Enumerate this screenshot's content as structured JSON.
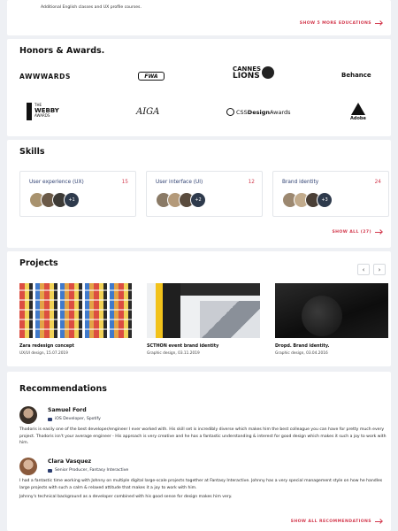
{
  "education": {
    "courses_line": "Additional English classes and UX profile courses.",
    "show_more": "SHOW 5 MORE EDUCATIONS"
  },
  "honors": {
    "title": "Honors & Awards.",
    "logos": {
      "awwwards": "AWWWARDS",
      "fwa": "FWA",
      "cannes_top": "CANNES",
      "cannes_bottom": "LIONS",
      "behance": "Behance",
      "webby_the": "THE",
      "webby_main": "WEBBY",
      "webby_awards": "AWARDS",
      "aiga": "AIGA",
      "css_prefix": "CSS",
      "css_design": "Design",
      "css_awards": "Awards",
      "adobe": "Adobe"
    }
  },
  "skills": {
    "title": "Skills",
    "items": [
      {
        "name": "User experience (UX)",
        "count": "15",
        "more": "+1"
      },
      {
        "name": "User interface (UI)",
        "count": "12",
        "more": "+2"
      },
      {
        "name": "Brand identity",
        "count": "24",
        "more": "+3"
      }
    ],
    "show_all": "SHOW ALL (27)"
  },
  "projects": {
    "title": "Projects",
    "prev": "‹",
    "next": "›",
    "items": [
      {
        "title": "Zara redesign concept",
        "meta": "UX/UI design, 15.07.2019"
      },
      {
        "title": "SCTHON event brand identity",
        "meta": "Graphic design, 03.11.2019"
      },
      {
        "title": "Dropd. Brand identity.",
        "meta": "Graphic design, 03.04.2016"
      }
    ]
  },
  "recommendations": {
    "title": "Recommendations",
    "items": [
      {
        "name": "Samuel Ford",
        "role": "iOS Developer, Spotify",
        "text": "Thodoris is easily one of the best developer/engineer I ever worked with. His skill set is incredibly diverse which makes him the best colleague you can have for pretty much every project. Thodoris isn't your average engineer - His approach is very creative and he has a fantastic understanding & interest for good design which makes it such a joy to work with him."
      },
      {
        "name": "Clara Vasquez",
        "role": "Senior Producer, Fantasy Interactive",
        "text": "I had a fantastic time working with Johnny on multiple digital large-scale projects together at Fantasy Interactive. Johnny has a very special management style on how he handles large projects with such a calm & relaxed attitude that makes it a joy to work with him.",
        "text2": "Johnny's technical background as a developer combined with his good sense for design makes him very."
      }
    ],
    "show_all": "SHOW ALL RECOMMENDATIONS"
  },
  "colors": {
    "accent": "#d33a4e",
    "navy": "#2c3e70",
    "background": "#eef0f4"
  }
}
